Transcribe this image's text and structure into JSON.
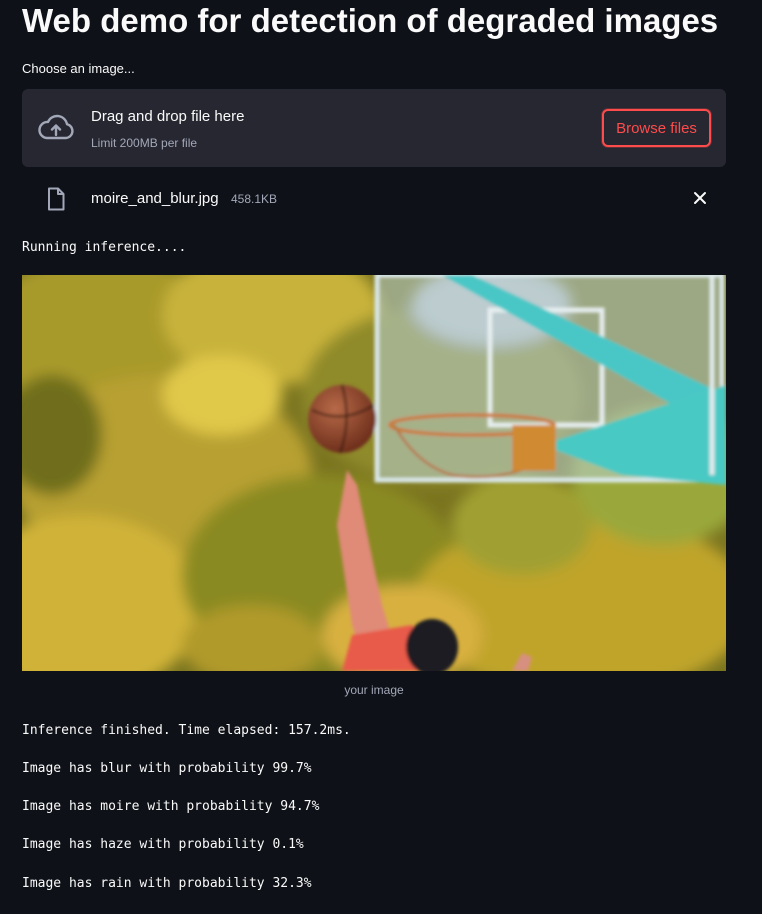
{
  "page": {
    "title": "Web demo for detection of degraded images"
  },
  "uploader": {
    "label": "Choose an image...",
    "drop_text": "Drag and drop file here",
    "limit_text": "Limit 200MB per file",
    "browse_label": "Browse files",
    "icon": "cloud-upload-icon"
  },
  "file": {
    "name": "moire_and_blur.jpg",
    "size": "458.1KB",
    "icon": "file-icon",
    "remove_icon": "close-icon"
  },
  "status": {
    "running": "Running inference...."
  },
  "image": {
    "caption": "your image"
  },
  "results": {
    "finished": "Inference finished. Time elapsed: 157.2ms.",
    "lines": [
      "Image has blur with probability 99.7%",
      "Image has moire with probability 94.7%",
      "Image has haze with probability 0.1%",
      "Image has rain with probability 32.3%"
    ]
  },
  "colors": {
    "background": "#0e1117",
    "panel": "#262730",
    "accent": "#ff4b4b"
  }
}
